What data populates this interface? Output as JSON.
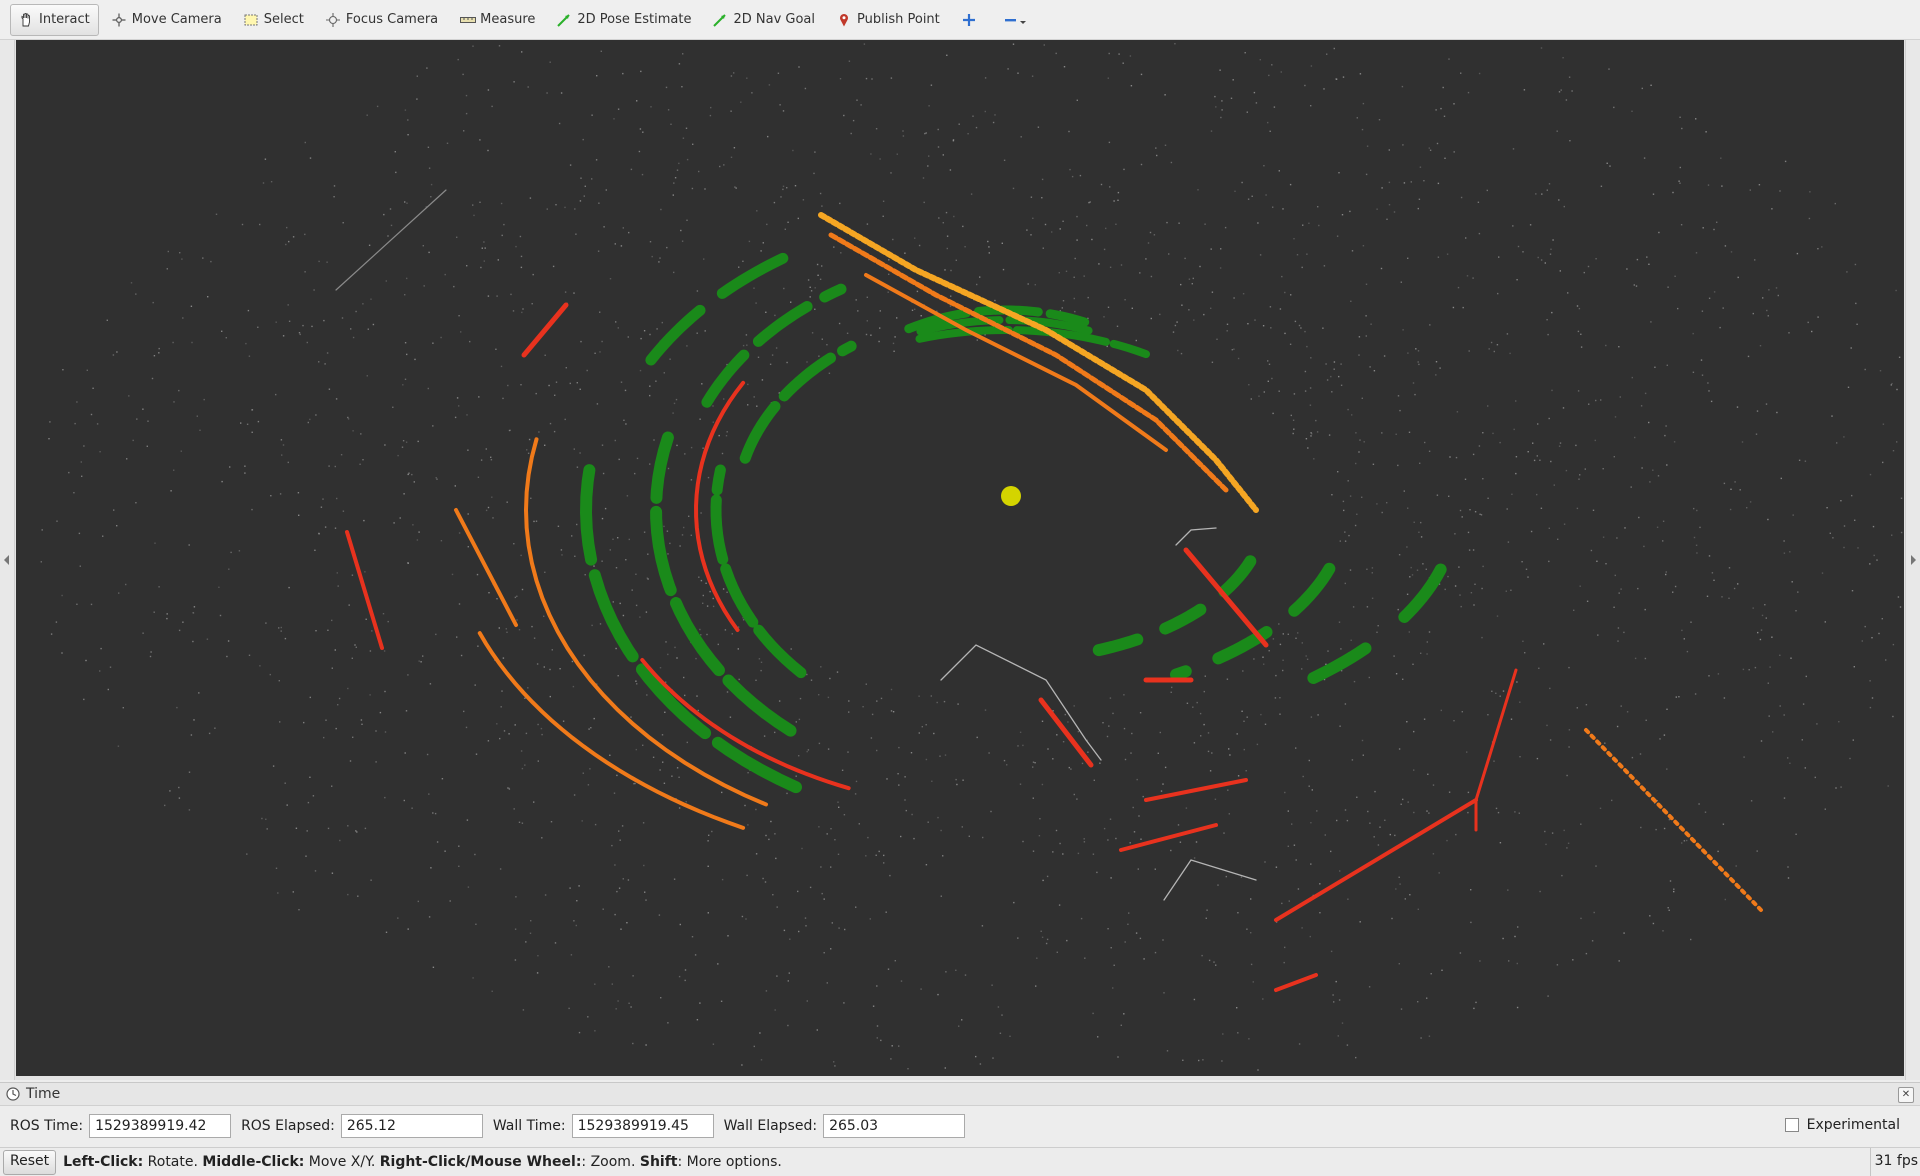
{
  "toolbar": {
    "tools": [
      {
        "label": "Interact",
        "icon": "hand-icon",
        "active": true
      },
      {
        "label": "Move Camera",
        "icon": "move-camera-icon"
      },
      {
        "label": "Select",
        "icon": "select-icon"
      },
      {
        "label": "Focus Camera",
        "icon": "focus-camera-icon"
      },
      {
        "label": "Measure",
        "icon": "ruler-icon"
      },
      {
        "label": "2D Pose Estimate",
        "icon": "green-arrow-icon"
      },
      {
        "label": "2D Nav Goal",
        "icon": "green-arrow-icon"
      },
      {
        "label": "Publish Point",
        "icon": "map-pin-icon"
      }
    ],
    "add_tool_icon": "plus-icon",
    "remove_tool_icon": "minus-dropdown-icon"
  },
  "viewport": {
    "background_color": "#303030",
    "point_colors": {
      "ground": "#1a8a1a",
      "near": "#e8321e",
      "mid": "#f07a1a",
      "far": "#f5a623",
      "noise": "#9a9a9a"
    },
    "robot_marker_color": "#d4d400"
  },
  "time_panel": {
    "title": "Time",
    "ros_time_label": "ROS Time:",
    "ros_time_value": "1529389919.42",
    "ros_elapsed_label": "ROS Elapsed:",
    "ros_elapsed_value": "265.12",
    "wall_time_label": "Wall Time:",
    "wall_time_value": "1529389919.45",
    "wall_elapsed_label": "Wall Elapsed:",
    "wall_elapsed_value": "265.03",
    "experimental_label": "Experimental"
  },
  "status": {
    "reset_label": "Reset",
    "hint_parts": [
      {
        "bold": "Left-Click:",
        "text": " Rotate. "
      },
      {
        "bold": "Middle-Click:",
        "text": " Move X/Y. "
      },
      {
        "bold": "Right-Click/Mouse Wheel:",
        "text": ": Zoom. "
      },
      {
        "bold": "Shift",
        "text": ": More options."
      }
    ],
    "fps": "31 fps"
  }
}
